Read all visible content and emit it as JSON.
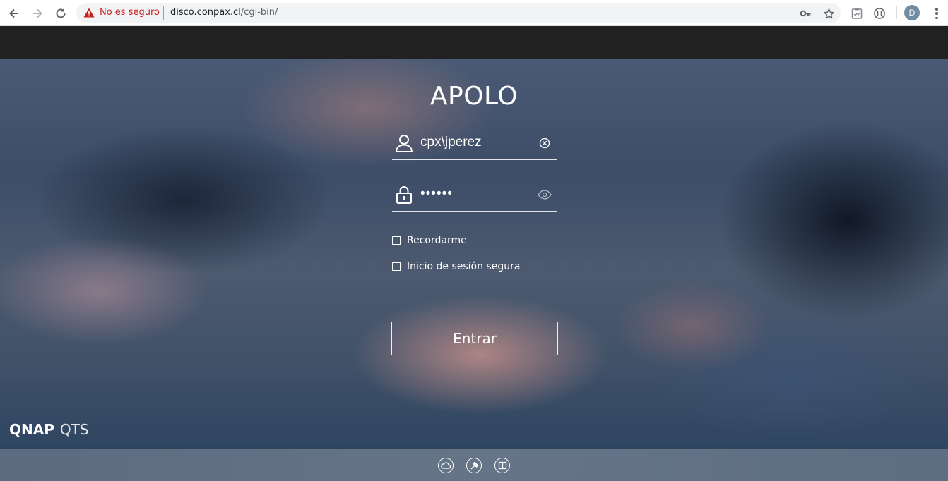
{
  "browser": {
    "security_label": "No es seguro",
    "url_host": "disco.conpax.cl",
    "url_path": "/cgi-bin/",
    "profile_initial": "D"
  },
  "login": {
    "title": "APOLO",
    "username_value": "cpx\\jperez",
    "password_value": "••••••",
    "remember_label": "Recordarme",
    "secure_login_label": "Inicio de sesión segura",
    "submit_label": "Entrar"
  },
  "brand": {
    "name": "QNAP",
    "product": "QTS"
  },
  "footer": {
    "icons": [
      "cloud-icon",
      "hammer-icon",
      "book-icon"
    ]
  },
  "colors": {
    "warning": "#c5221f",
    "text_light": "#ffffff",
    "top_bar": "#212121"
  }
}
